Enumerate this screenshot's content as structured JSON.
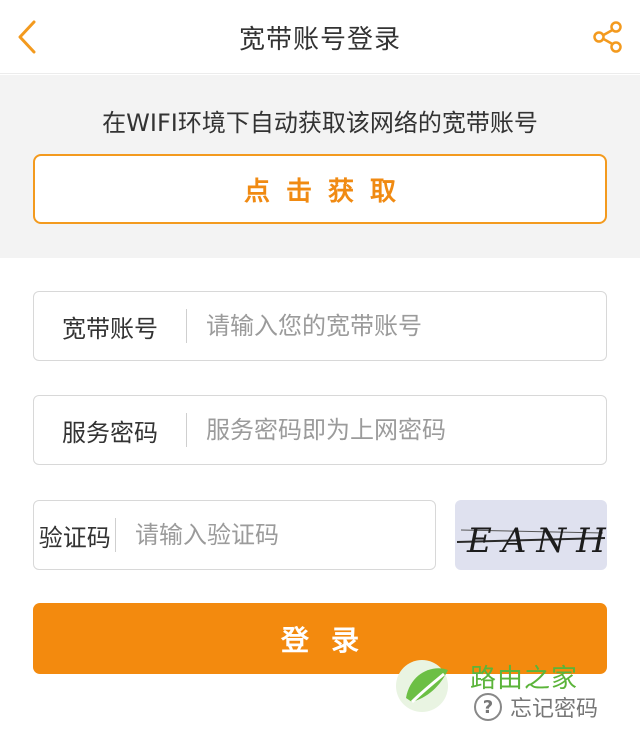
{
  "header": {
    "title": "宽带账号登录",
    "back_icon": "chevron-left-icon",
    "share_icon": "share-icon"
  },
  "auto_get": {
    "hint": "在WIFI环境下自动获取该网络的宽带账号",
    "button_label": "点击获取"
  },
  "form": {
    "account": {
      "label": "宽带账号",
      "placeholder": "请输入您的宽带账号",
      "value": ""
    },
    "password": {
      "label": "服务密码",
      "placeholder": "服务密码即为上网密码",
      "value": ""
    },
    "captcha": {
      "label": "验证码",
      "placeholder": "请输入验证码",
      "value": "",
      "image_text": "EANH"
    }
  },
  "login_button": "登录",
  "watermark": {
    "text": "路由之家"
  },
  "forgot_password": {
    "icon": "question-circle-icon",
    "label": "忘记密码",
    "icon_glyph": "?"
  },
  "colors": {
    "accent": "#f38a0e",
    "panel_bg": "#f3f3f3",
    "watermark_green": "#5bb43a"
  }
}
